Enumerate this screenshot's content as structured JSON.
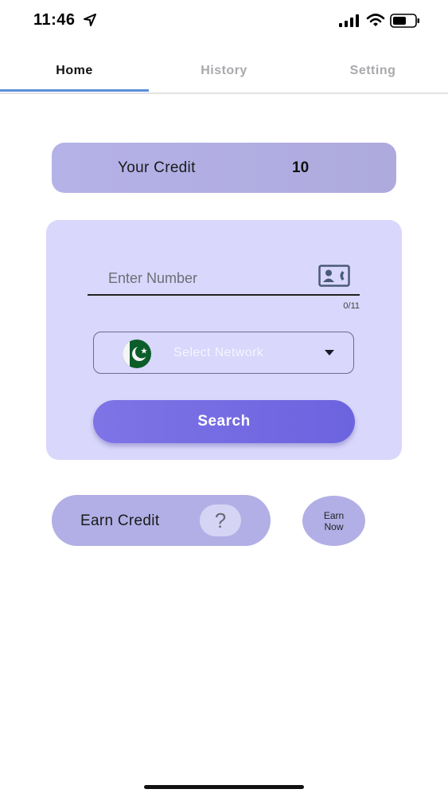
{
  "status_bar": {
    "time": "11:46",
    "icons": [
      "location-arrow-icon",
      "cellular-signal-icon",
      "wifi-icon",
      "battery-icon"
    ]
  },
  "tabs": [
    {
      "label": "Home",
      "active": true
    },
    {
      "label": "History",
      "active": false
    },
    {
      "label": "Setting",
      "active": false
    }
  ],
  "credit": {
    "label": "Your Credit",
    "value": "10"
  },
  "search_form": {
    "number_placeholder": "Enter Number",
    "number_value": "",
    "counter": "0/11",
    "network_placeholder": "Select Network",
    "flag_icon": "pakistan-flag-icon",
    "search_label": "Search"
  },
  "earn": {
    "earn_credit_label": "Earn Credit",
    "help_symbol": "?",
    "earn_now_line1": "Earn",
    "earn_now_line2": "Now"
  },
  "colors": {
    "accent": "#6c63df",
    "panel": "#d9d7fb",
    "card": "#b2afe6",
    "tab_indicator": "#5b8fd8"
  }
}
